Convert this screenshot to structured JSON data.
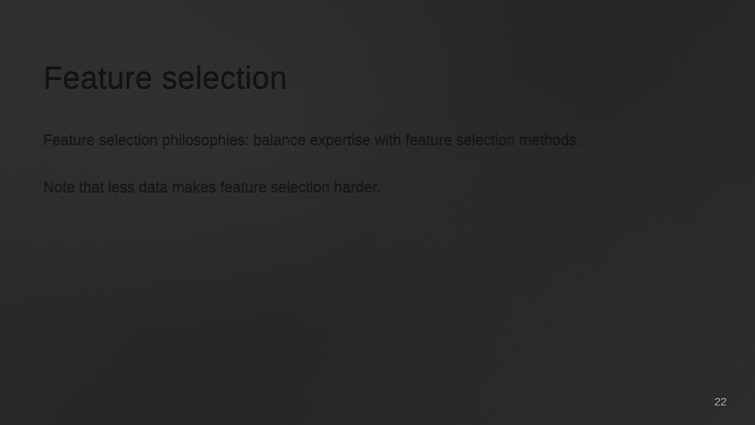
{
  "slide": {
    "title": "Feature selection",
    "paragraphs": [
      "Feature selection philosophies: balance expertise with feature selection methods.",
      "Note that less data makes feature selection harder."
    ],
    "page_number": "22"
  }
}
